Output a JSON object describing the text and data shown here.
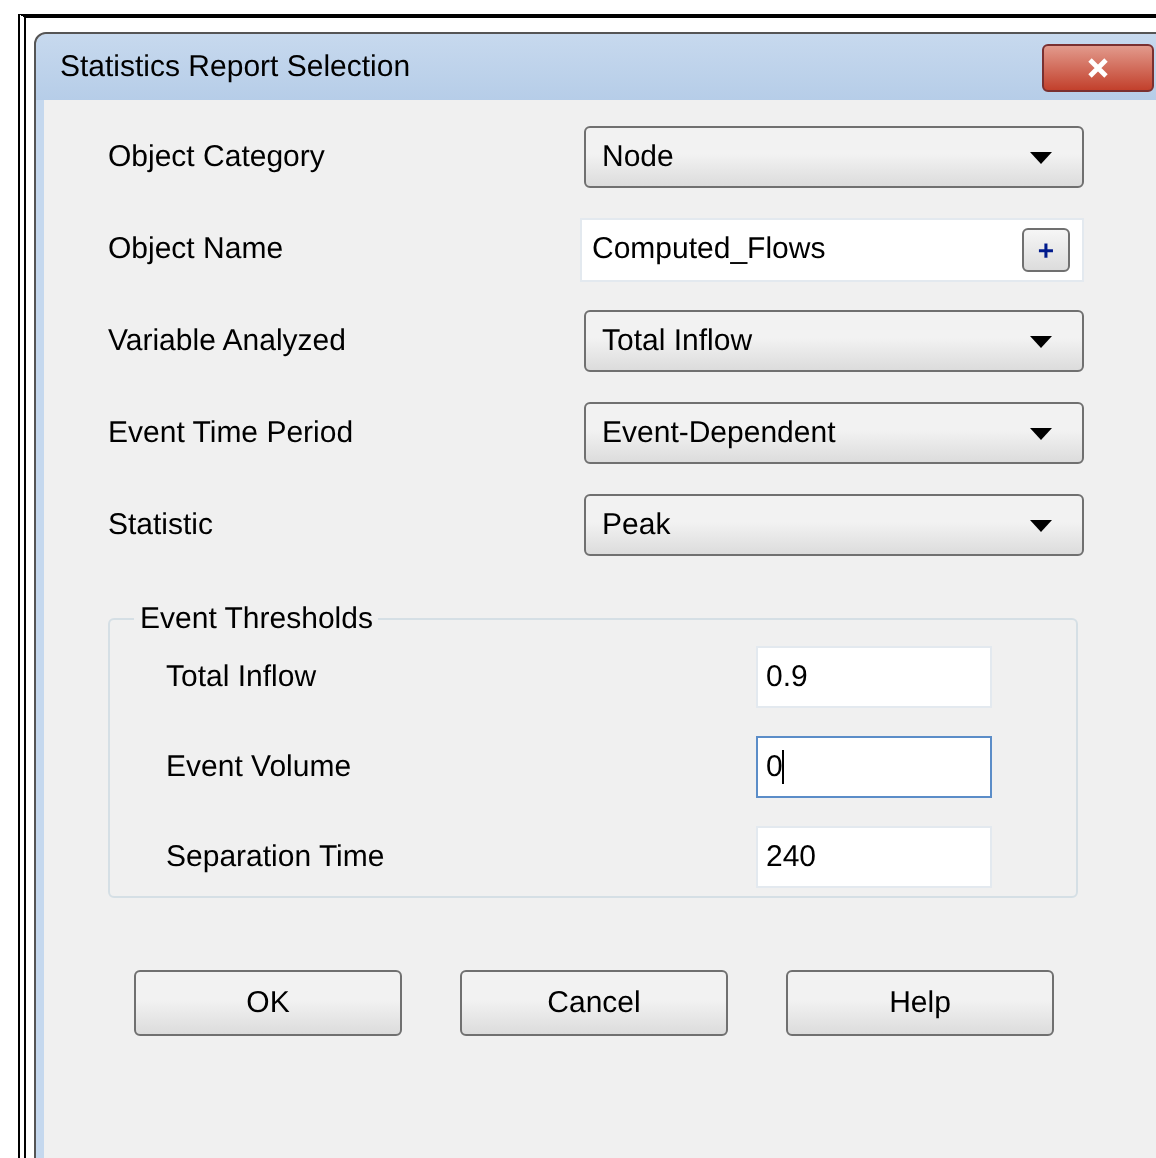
{
  "window": {
    "title": "Statistics Report Selection"
  },
  "fields": [
    {
      "label": "Object Category",
      "kind": "dropdown",
      "value": "Node"
    },
    {
      "label": "Object Name",
      "kind": "text-with-button",
      "value": "Computed_Flows",
      "button": "+"
    },
    {
      "label": "Variable Analyzed",
      "kind": "dropdown",
      "value": "Total Inflow"
    },
    {
      "label": "Event Time Period",
      "kind": "dropdown",
      "value": "Event-Dependent"
    },
    {
      "label": "Statistic",
      "kind": "dropdown",
      "value": "Peak"
    }
  ],
  "thresholds": {
    "title": "Event Thresholds",
    "fields": [
      {
        "label": "Total Inflow",
        "value": "0.9",
        "focused": false
      },
      {
        "label": "Event Volume",
        "value": "0",
        "focused": true
      },
      {
        "label": "Separation Time",
        "value": "240",
        "focused": false
      }
    ]
  },
  "buttons": [
    "OK",
    "Cancel",
    "Help"
  ]
}
